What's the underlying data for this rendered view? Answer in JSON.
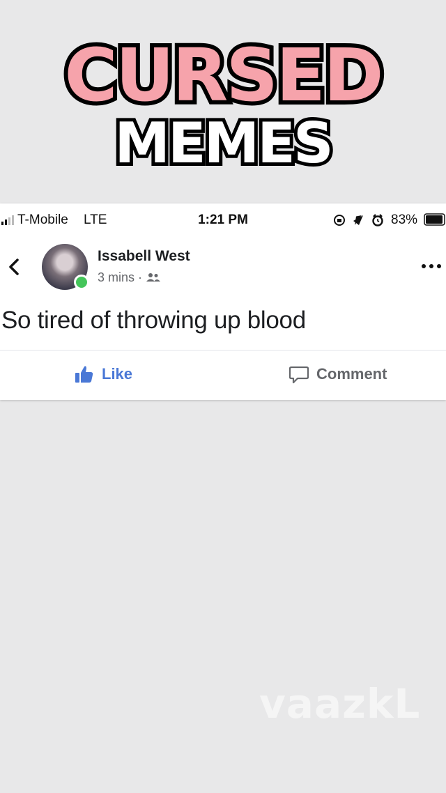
{
  "overlay": {
    "title_line1": "CURSED",
    "title_line2": "MEMES",
    "watermark": "vaazkL"
  },
  "status_bar": {
    "carrier": "T-Mobile",
    "network": "LTE",
    "time": "1:21 PM",
    "battery_percent": "83%",
    "icons": [
      "signal-bars-icon",
      "orientation-lock-icon",
      "location-arrow-icon",
      "alarm-icon",
      "battery-icon"
    ]
  },
  "post": {
    "author": "Issabell West",
    "timestamp": "3 mins",
    "separator": "·",
    "audience_icon": "friends-icon",
    "text": "So tired of throwing up blood",
    "online": true
  },
  "actions": {
    "like_label": "Like",
    "comment_label": "Comment"
  },
  "colors": {
    "title_pink": "#f6a3ab",
    "like_blue": "#4a78d6",
    "online_green": "#44c55a",
    "background": "#e8e8e9"
  }
}
